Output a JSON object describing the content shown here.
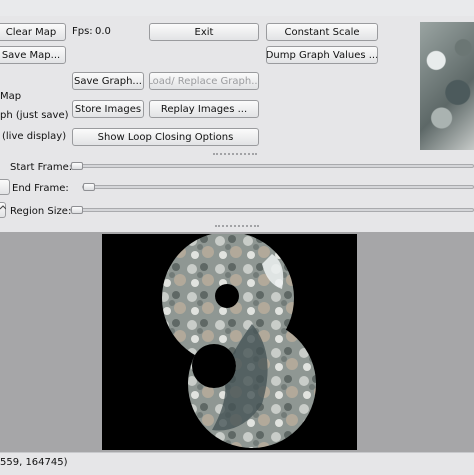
{
  "controls": {
    "clear_map": "Clear Map",
    "save_map": "Save Map...",
    "fps_label": "Fps:",
    "fps_value": "0.0",
    "exit": "Exit",
    "constant_scale": "Constant Scale",
    "dump_graph_values": "Dump Graph Values ...",
    "save_graph": "Save Graph...",
    "load_replace_graph": "Load/ Replace Graph...",
    "store_images": "Store Images",
    "replay_images": "Replay Images ...",
    "show_loop_closing": "Show Loop Closing Options",
    "option_map": "Map",
    "option_graph_just_save": "ph (just save)",
    "option_live_display": "(live display)"
  },
  "sliders": {
    "start_frame_label": "Start Frame:",
    "end_frame_label": "End Frame:",
    "region_size_label": "Region Size:",
    "start_frame_value": 0,
    "end_frame_value": 0,
    "region_size_value": 0
  },
  "status_bar": {
    "text": "559, 164745)"
  },
  "icons": {
    "spin_up": "arrow-up-icon"
  }
}
